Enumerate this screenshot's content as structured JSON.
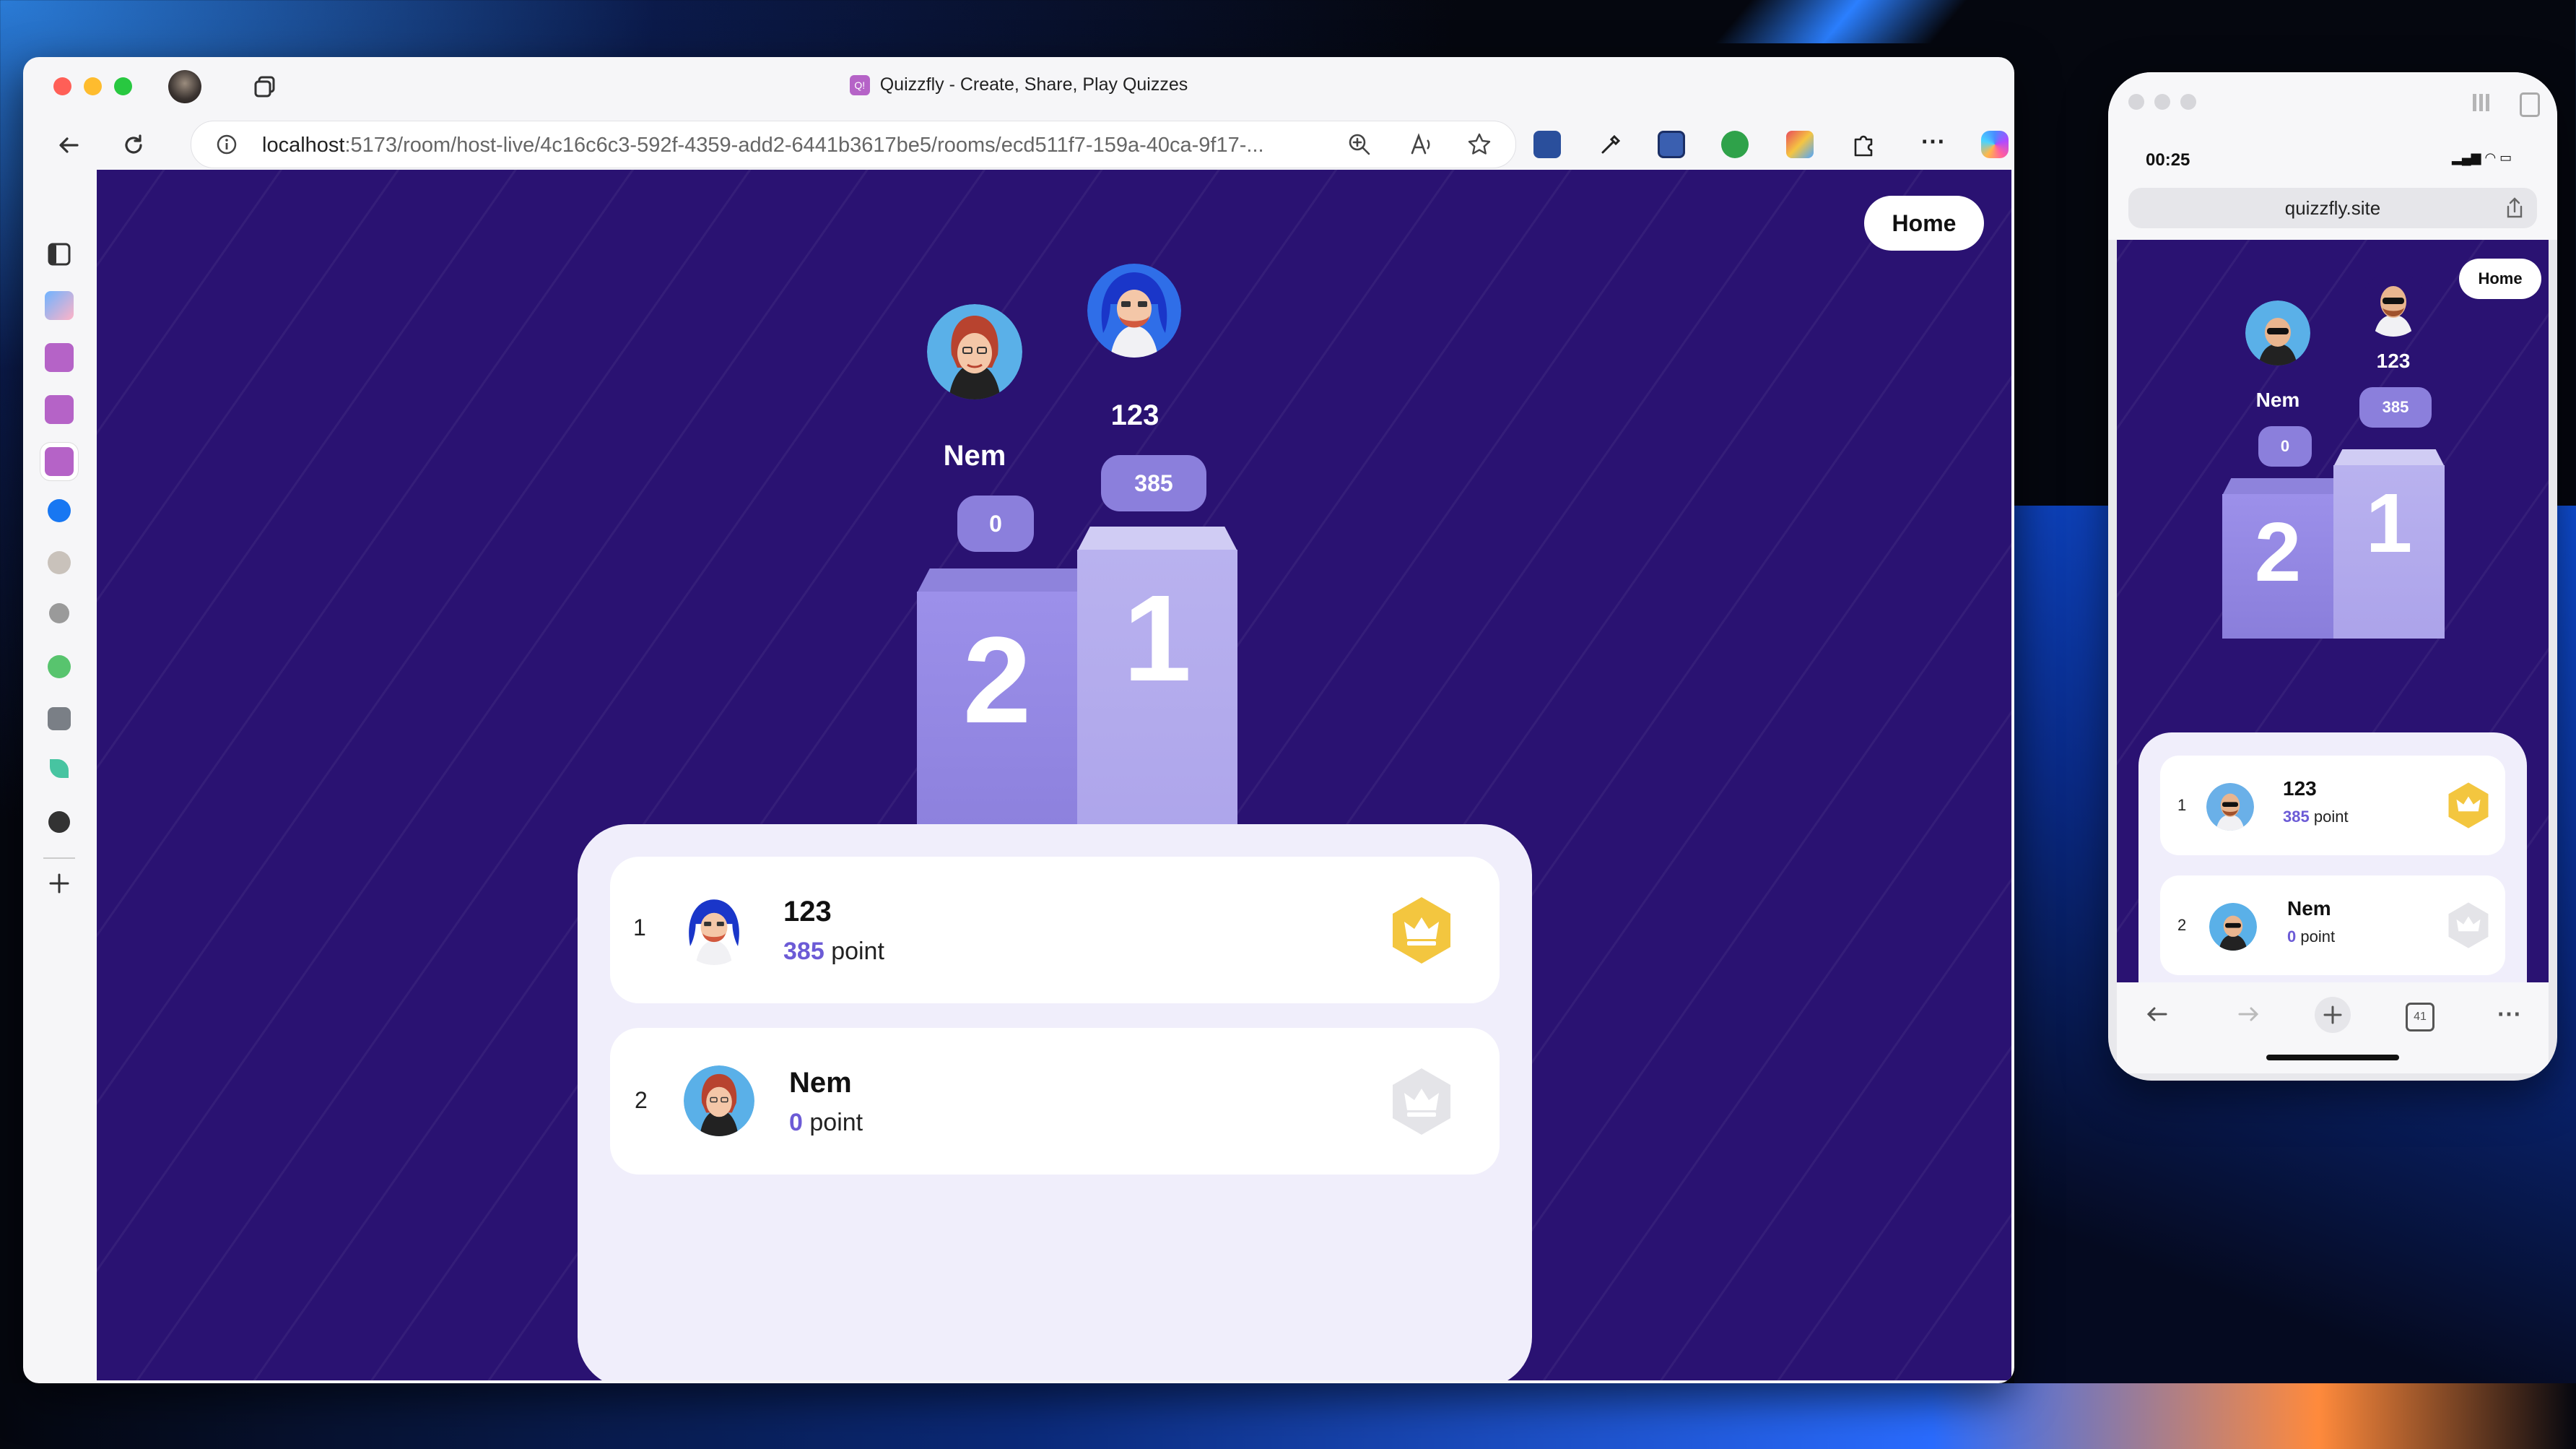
{
  "browser": {
    "title": "Quizzfly - Create, Share, Play Quizzes",
    "favicon_text": "Q!",
    "url_host": "localhost",
    "url_rest": ":5173/room/host-live/4c16c6c3-592f-4359-add2-6441b3617be5/rooms/ecd511f7-159a-40ca-9f17-...",
    "colors": {
      "close": "#ff5f57",
      "minimize": "#febc2e",
      "maximize": "#28c840"
    }
  },
  "page": {
    "home_label": "Home",
    "podium": [
      {
        "place": "1",
        "name": "123",
        "score": "385"
      },
      {
        "place": "2",
        "name": "Nem",
        "score": "0"
      }
    ],
    "leaderboard": [
      {
        "rank": "1",
        "name": "123",
        "points": "385",
        "unit": "point",
        "badge": "gold-crown-icon"
      },
      {
        "rank": "2",
        "name": "Nem",
        "points": "0",
        "unit": "point",
        "badge": "gray-crown-icon"
      }
    ],
    "colors": {
      "background": "#2a1272",
      "accent": "#6c5bd6",
      "gold": "#f3c63f",
      "silver": "#e4e4e8"
    }
  },
  "phone": {
    "time": "00:25",
    "url": "quizzfly.site",
    "home_label": "Home",
    "tab_count": "41",
    "podium": [
      {
        "place": "1",
        "name": "123",
        "score": "385"
      },
      {
        "place": "2",
        "name": "Nem",
        "score": "0"
      }
    ],
    "leaderboard": [
      {
        "rank": "1",
        "name": "123",
        "points": "385",
        "unit": "point"
      },
      {
        "rank": "2",
        "name": "Nem",
        "points": "0",
        "unit": "point"
      }
    ]
  }
}
